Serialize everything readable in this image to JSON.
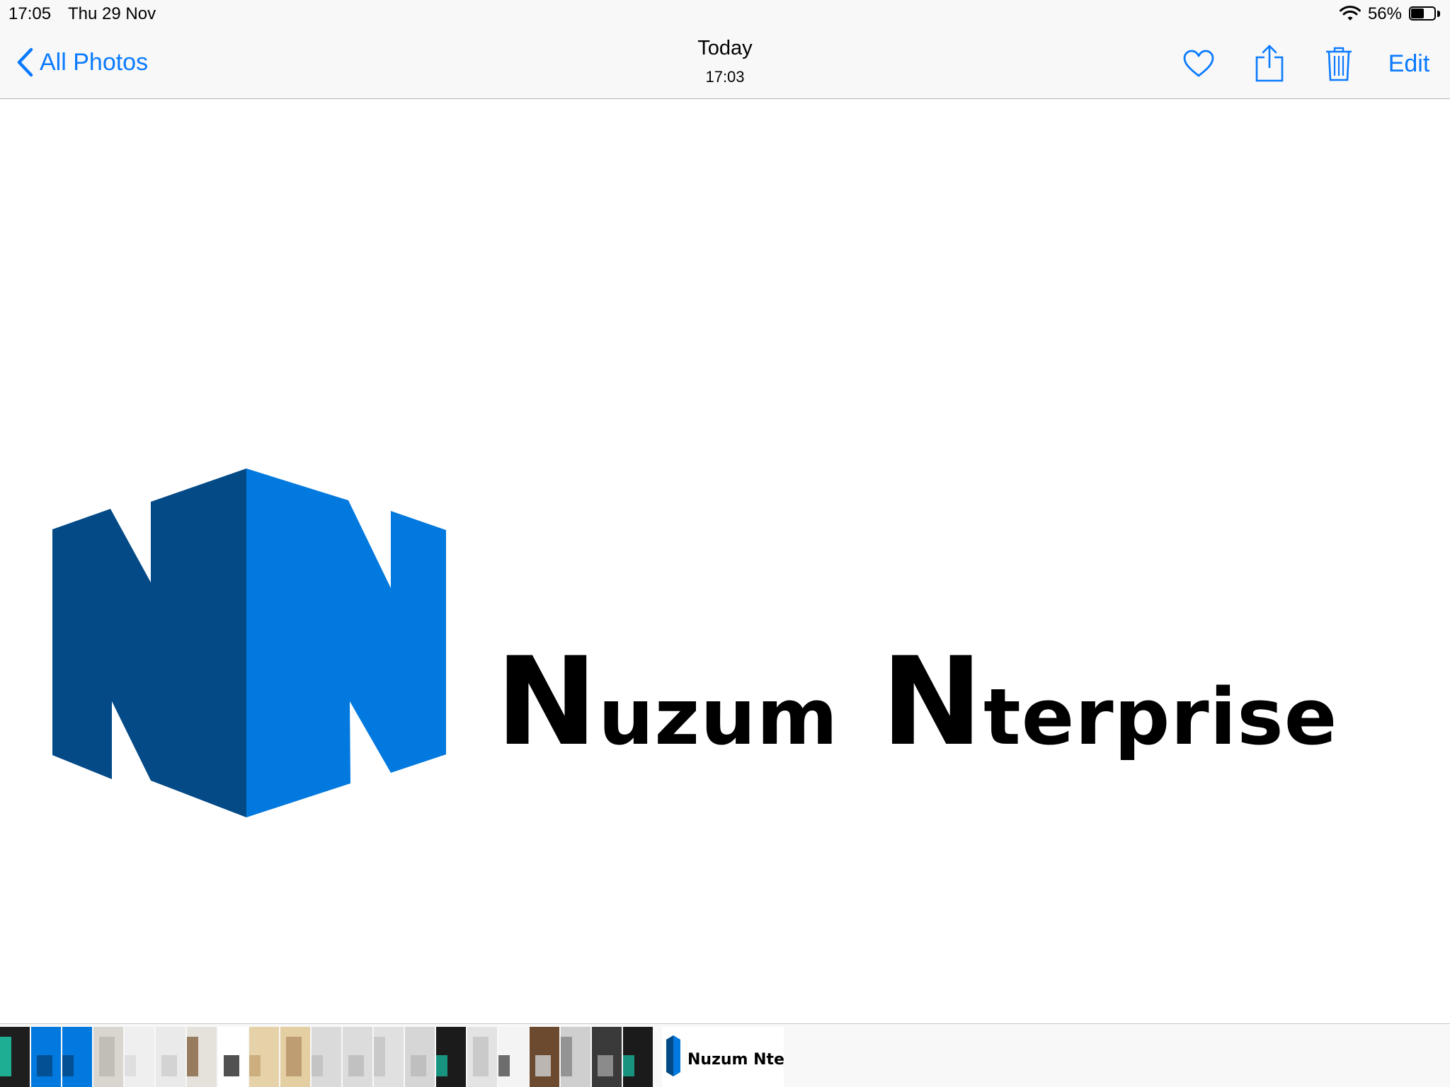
{
  "status_bar": {
    "time": "17:05",
    "date": "Thu 29 Nov",
    "battery_text": "56%",
    "battery_level": 0.56
  },
  "nav": {
    "back_label": "All Photos",
    "title": "Today",
    "subtitle": "17:03",
    "edit_label": "Edit",
    "icons": [
      "heart-icon",
      "share-icon",
      "trash-icon"
    ]
  },
  "photo": {
    "logo_text_word1_cap": "N",
    "logo_text_word1_rest": "uzum",
    "logo_text_word2_cap": "N",
    "logo_text_word2_rest": "terprise",
    "colors": {
      "dark_blue": "#034a87",
      "light_blue": "#0279de",
      "text": "#000000"
    }
  },
  "filmstrip": {
    "current_caption": "Nuzum Nte",
    "thumbnails": [
      {
        "bg": "#1e1e1e",
        "accent": "#1ec8a8"
      },
      {
        "bg": "#0279de",
        "accent": "#034a87"
      },
      {
        "bg": "#0279de",
        "accent": "#034a87"
      },
      {
        "bg": "#d8d6cf",
        "accent": "#bdbab0"
      },
      {
        "bg": "#efefef",
        "accent": "#dcdcdc"
      },
      {
        "bg": "#eaeaea",
        "accent": "#cfcfcf"
      },
      {
        "bg": "#e5e2dc",
        "accent": "#8a6a4a"
      },
      {
        "bg": "#ffffff",
        "accent": "#333333"
      },
      {
        "bg": "#e6d2a8",
        "accent": "#c8a878"
      },
      {
        "bg": "#e4cfa3",
        "accent": "#b8946a"
      },
      {
        "bg": "#dadada",
        "accent": "#c0c0c0"
      },
      {
        "bg": "#dcdcdc",
        "accent": "#bcbcbc"
      },
      {
        "bg": "#e0e0e0",
        "accent": "#c4c4c4"
      },
      {
        "bg": "#d6d6d6",
        "accent": "#bbbbbb"
      },
      {
        "bg": "#1b1b1b",
        "accent": "#18a890"
      },
      {
        "bg": "#e3e3e3",
        "accent": "#c6c6c6"
      },
      {
        "bg": "#f4f4f4",
        "accent": "#555555"
      },
      {
        "bg": "#6b4a2f",
        "accent": "#c9c9c9"
      },
      {
        "bg": "#cfcfcf",
        "accent": "#8a8a8a"
      },
      {
        "bg": "#3a3a3a",
        "accent": "#9a9a9a"
      },
      {
        "bg": "#1b1b1b",
        "accent": "#18a890"
      }
    ]
  }
}
